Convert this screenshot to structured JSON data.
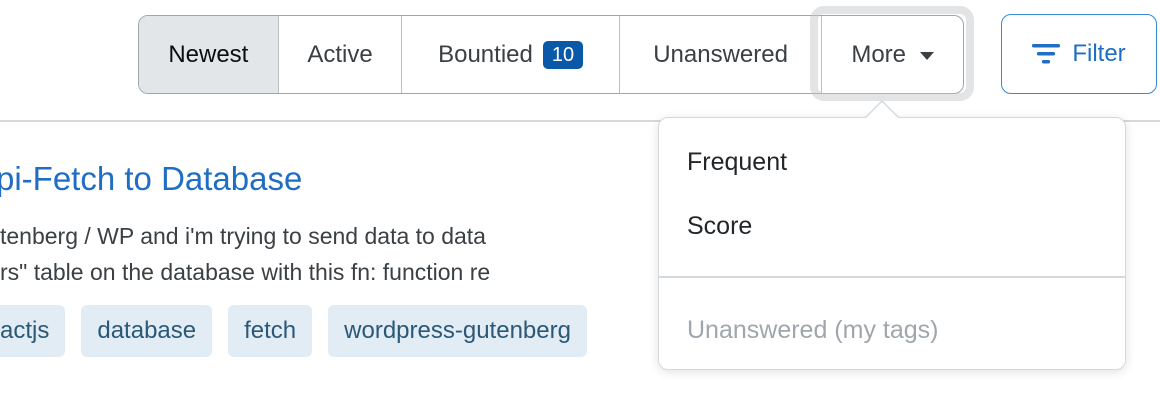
{
  "tabs": {
    "newest": "Newest",
    "active": "Active",
    "bountied": "Bountied",
    "bountied_count": "10",
    "unanswered": "Unanswered",
    "more": "More"
  },
  "filter": {
    "label": "Filter"
  },
  "question": {
    "title": "pi-Fetch to Database",
    "excerpt_line1": "tenberg / WP and i'm trying to send data to data",
    "excerpt_line2": "rs\" table on the database with this fn: function re",
    "tags": [
      "actjs",
      "database",
      "fetch",
      "wordpress-gutenberg"
    ]
  },
  "dropdown": {
    "items": [
      "Frequent",
      "Score"
    ],
    "disabled_item": "Unanswered (my tags)"
  },
  "colors": {
    "link": "#1f6ec4",
    "badge": "#0a58a8",
    "tag_bg": "#e1ecf4",
    "tag_text": "#2c5877",
    "selected_tab": "#e3e6e8"
  }
}
